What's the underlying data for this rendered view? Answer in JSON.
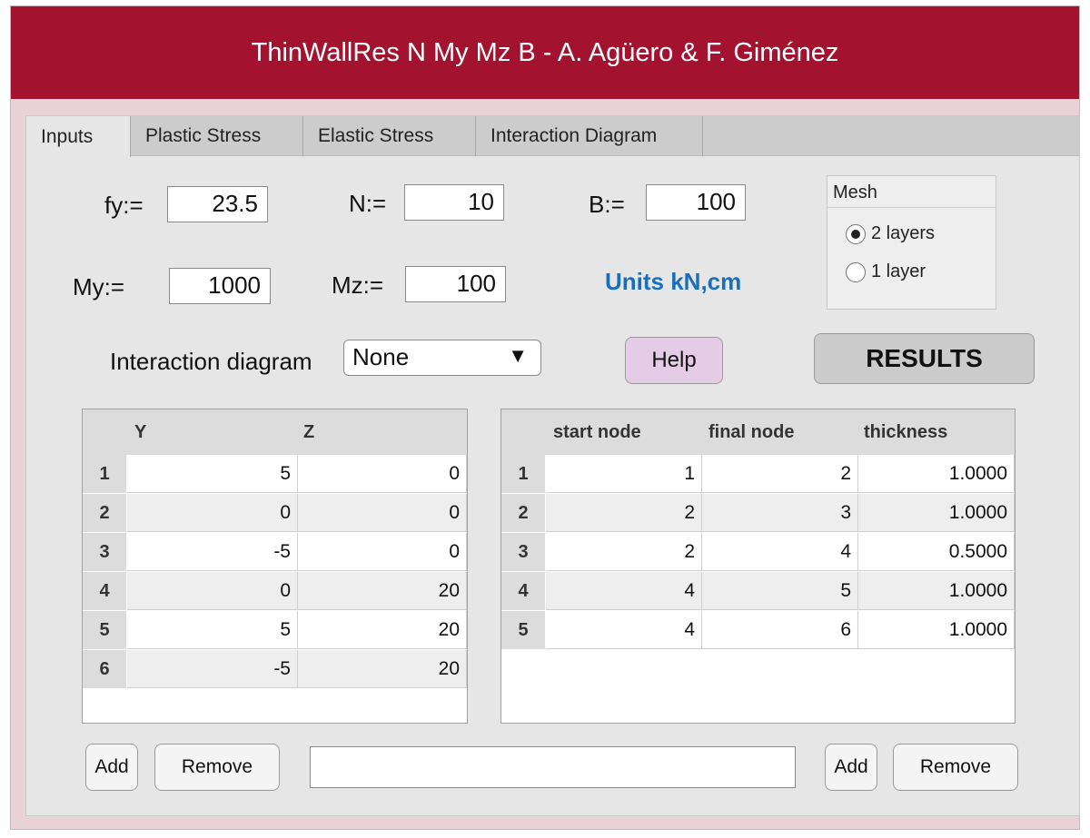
{
  "window": {
    "title": "ThinWallRes N My Mz B - A. Agüero & F. Giménez"
  },
  "tabs": [
    "Inputs",
    "Plastic Stress",
    "Elastic Stress",
    "Interaction Diagram"
  ],
  "inputs": {
    "fy_label": "fy:=",
    "fy_value": "23.5",
    "n_label": "N:=",
    "n_value": "10",
    "b_label": "B:=",
    "b_value": "100",
    "my_label": "My:=",
    "my_value": "1000",
    "mz_label": "Mz:=",
    "mz_value": "100",
    "units": "Units kN,cm"
  },
  "mesh": {
    "title": "Mesh",
    "options": [
      "2 layers",
      "1 layer"
    ],
    "selected": "2 layers"
  },
  "interaction": {
    "label": "Interaction diagram",
    "selected": "None",
    "arrow": "▼"
  },
  "buttons": {
    "help": "Help",
    "results": "RESULTS",
    "add": "Add",
    "remove": "Remove"
  },
  "nodes_table": {
    "headers": [
      "Y",
      "Z"
    ],
    "rows": [
      {
        "n": "1",
        "y": "5",
        "z": "0"
      },
      {
        "n": "2",
        "y": "0",
        "z": "0"
      },
      {
        "n": "3",
        "y": "-5",
        "z": "0"
      },
      {
        "n": "4",
        "y": "0",
        "z": "20"
      },
      {
        "n": "5",
        "y": "5",
        "z": "20"
      },
      {
        "n": "6",
        "y": "-5",
        "z": "20"
      }
    ]
  },
  "elements_table": {
    "headers": [
      "start node",
      "final node",
      "thickness"
    ],
    "rows": [
      {
        "n": "1",
        "start": "1",
        "final": "2",
        "t": "1.0000"
      },
      {
        "n": "2",
        "start": "2",
        "final": "3",
        "t": "1.0000"
      },
      {
        "n": "3",
        "start": "2",
        "final": "4",
        "t": "0.5000"
      },
      {
        "n": "4",
        "start": "4",
        "final": "5",
        "t": "1.0000"
      },
      {
        "n": "5",
        "start": "4",
        "final": "6",
        "t": "1.0000"
      }
    ]
  },
  "status_field": {
    "value": ""
  },
  "colors": {
    "titlebar": "#a3132f",
    "units": "#1a6fba",
    "help_button": "#e4cbe6"
  }
}
